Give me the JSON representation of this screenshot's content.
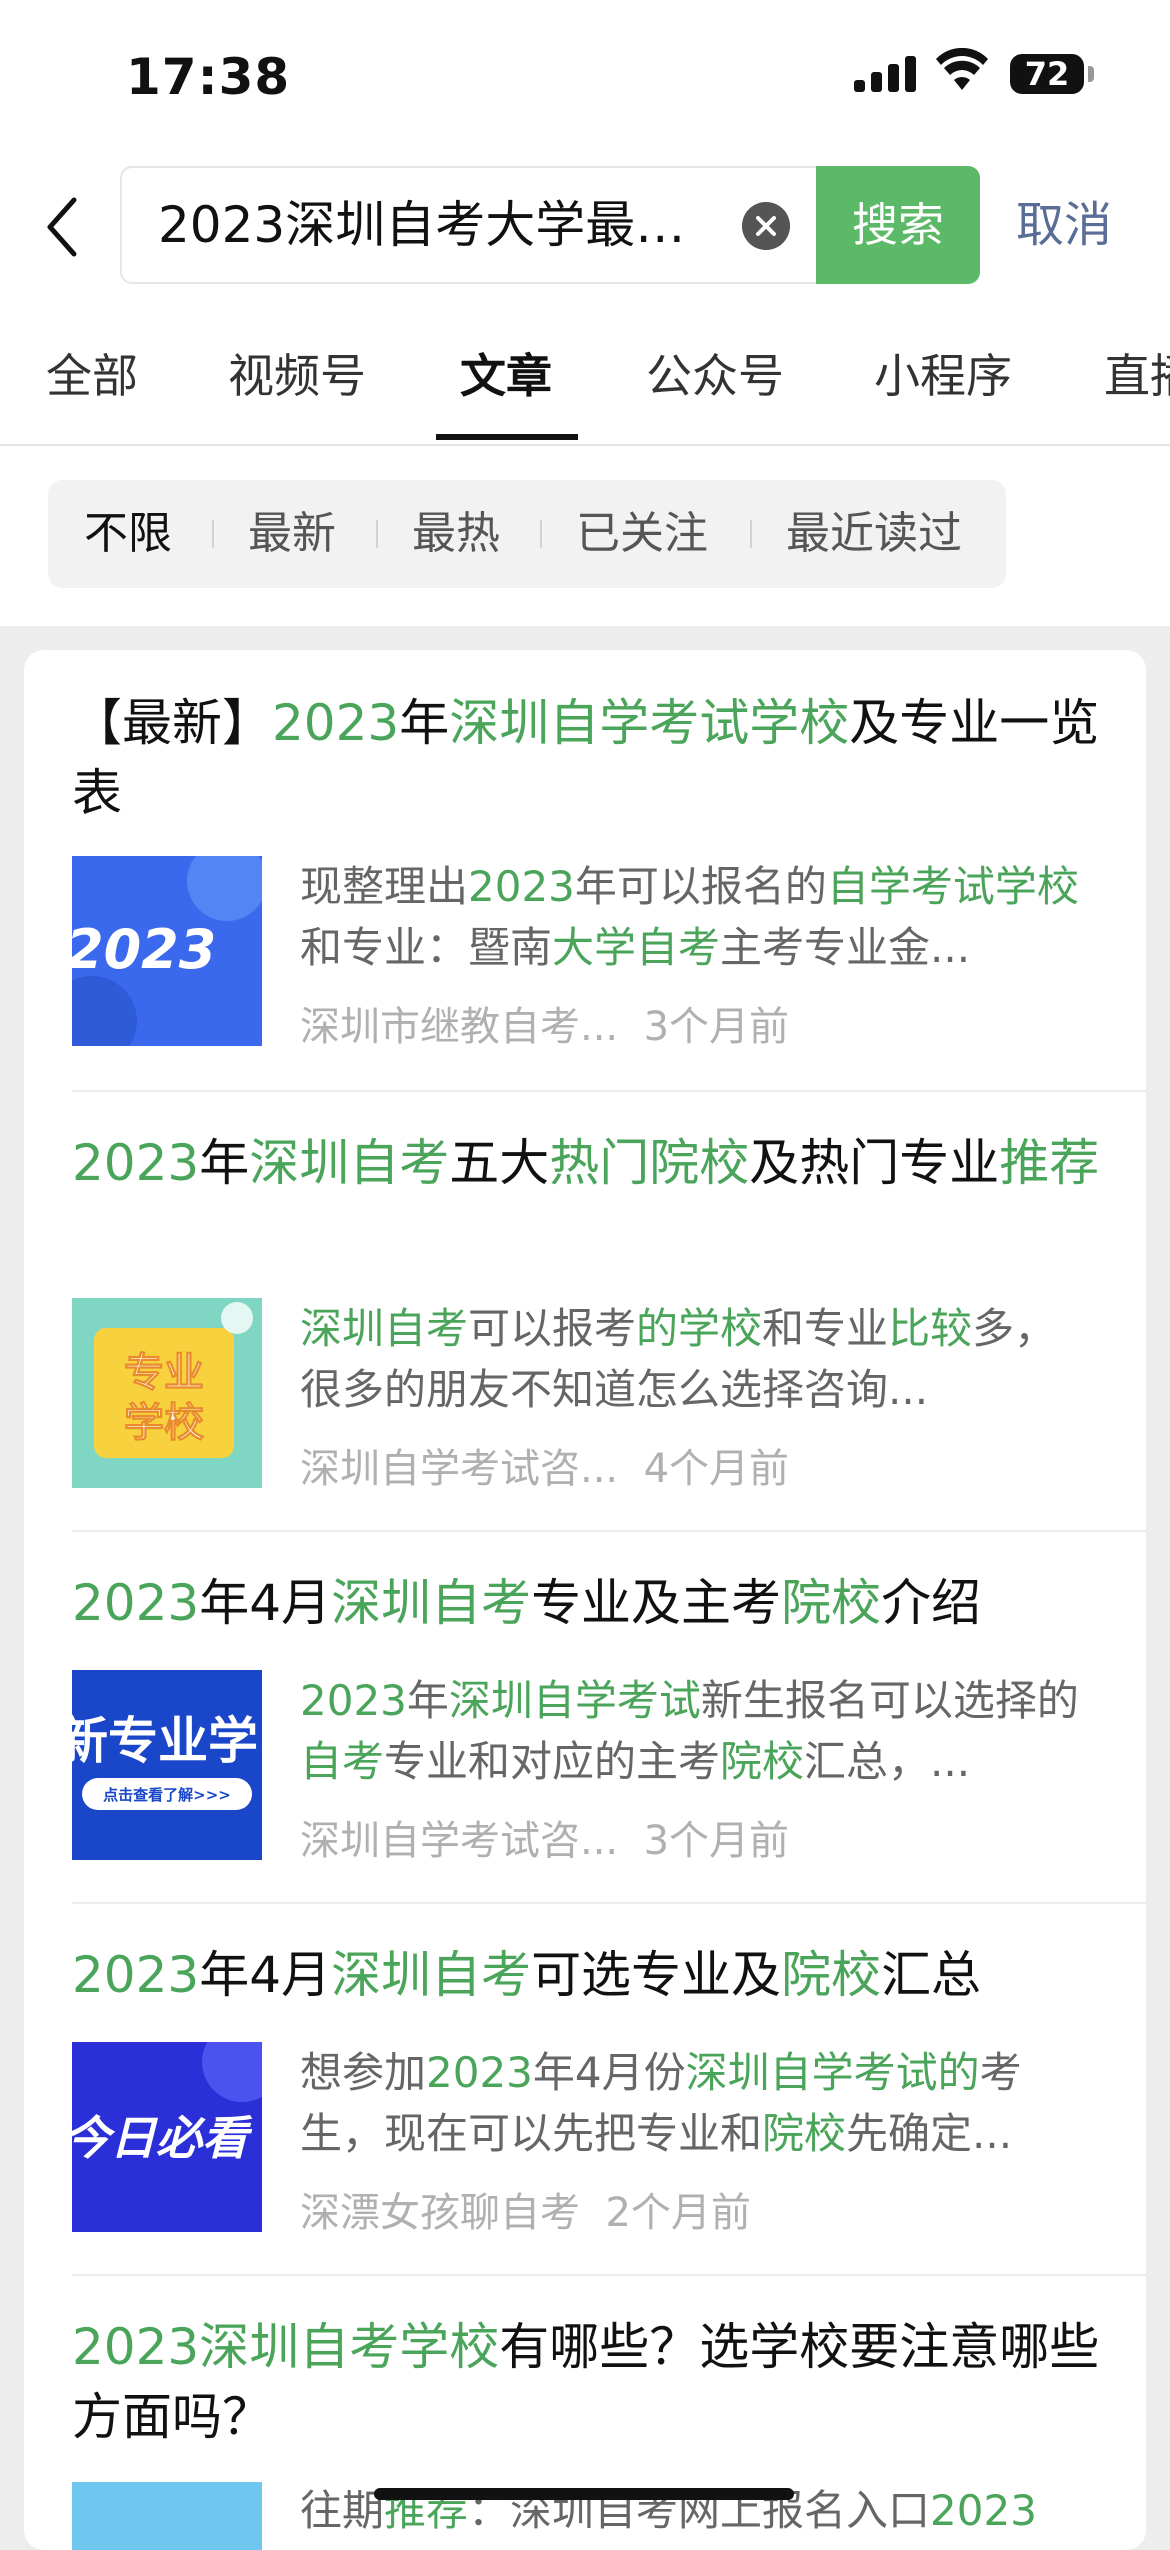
{
  "status": {
    "time": "17:38",
    "battery": "72"
  },
  "search": {
    "query": "2023深圳自考大学最…",
    "button": "搜索",
    "cancel": "取消"
  },
  "tabs": [
    "全部",
    "视频号",
    "文章",
    "公众号",
    "小程序",
    "直播"
  ],
  "active_tab": "文章",
  "filters": [
    "不限",
    "最新",
    "最热",
    "已关注",
    "最近读过"
  ],
  "active_filter": "不限",
  "articles": [
    {
      "title": [
        [
          "【最新】",
          false
        ],
        [
          "2023",
          true
        ],
        [
          "年",
          false
        ],
        [
          "深圳自学考试学校",
          true
        ],
        [
          "及专业一览表",
          false
        ]
      ],
      "snippet": [
        [
          "现整理出",
          false
        ],
        [
          "2023",
          true
        ],
        [
          "年可以报名的",
          false
        ],
        [
          "自学考试学校",
          true
        ],
        [
          "和专业：暨南",
          false
        ],
        [
          "大学自考",
          true
        ],
        [
          "主考专业金...",
          false
        ]
      ],
      "source": "深圳市继教自考...",
      "time": "3个月前",
      "thumb_text": "2023"
    },
    {
      "title": [
        [
          "2023",
          true
        ],
        [
          "年",
          false
        ],
        [
          "深圳自考",
          true
        ],
        [
          "五大",
          false
        ],
        [
          "热门院校",
          true
        ],
        [
          "及热门专业",
          false
        ],
        [
          "推荐",
          true
        ]
      ],
      "snippet": [
        [
          "深圳自考",
          true
        ],
        [
          "可以报考",
          false
        ],
        [
          "的学校",
          true
        ],
        [
          "和专业",
          false
        ],
        [
          "比较",
          true
        ],
        [
          "多，很多的朋友不知道怎么选择咨询...",
          false
        ]
      ],
      "source": "深圳自学考试咨...",
      "time": "4个月前",
      "thumb_text": "专业\n学校"
    },
    {
      "title": [
        [
          "2023",
          true
        ],
        [
          "年4月",
          false
        ],
        [
          "深圳自考",
          true
        ],
        [
          "专业及主考",
          false
        ],
        [
          "院校",
          true
        ],
        [
          "介绍",
          false
        ]
      ],
      "snippet": [
        [
          "2023",
          true
        ],
        [
          "年",
          false
        ],
        [
          "深圳自学考试",
          true
        ],
        [
          "新生报名可以选择的",
          false
        ],
        [
          "自考",
          true
        ],
        [
          "专业和对应的主考",
          false
        ],
        [
          "院校",
          true
        ],
        [
          "汇总，...",
          false
        ]
      ],
      "source": "深圳自学考试咨...",
      "time": "3个月前",
      "thumb_text": "新专业学",
      "thumb_sub": "点击查看了解>>>"
    },
    {
      "title": [
        [
          "2023",
          true
        ],
        [
          "年4月",
          false
        ],
        [
          "深圳自考",
          true
        ],
        [
          "可选专业及",
          false
        ],
        [
          "院校",
          true
        ],
        [
          "汇总",
          false
        ]
      ],
      "snippet": [
        [
          "想参加",
          false
        ],
        [
          "2023",
          true
        ],
        [
          "年4月份",
          false
        ],
        [
          "深圳自学考试的",
          true
        ],
        [
          "考生，现在可以先把专业和",
          false
        ],
        [
          "院校",
          true
        ],
        [
          "先确定...",
          false
        ]
      ],
      "source": "深漂女孩聊自考",
      "time": "2个月前",
      "thumb_text": "今日必看"
    },
    {
      "title": [
        [
          "2023",
          true
        ],
        [
          "深圳自考学校",
          true
        ],
        [
          "有哪些？选学校要注意哪些方面吗？",
          false
        ]
      ],
      "snippet": [
        [
          "往期",
          false
        ],
        [
          "推荐",
          true
        ],
        [
          "：深圳自考网上报名入口",
          false
        ],
        [
          "2023",
          true
        ]
      ],
      "source": "",
      "time": ""
    }
  ],
  "colors": {
    "highlight": "#4aa45a",
    "search_button": "#5cb968",
    "cancel": "#5a6d96"
  }
}
